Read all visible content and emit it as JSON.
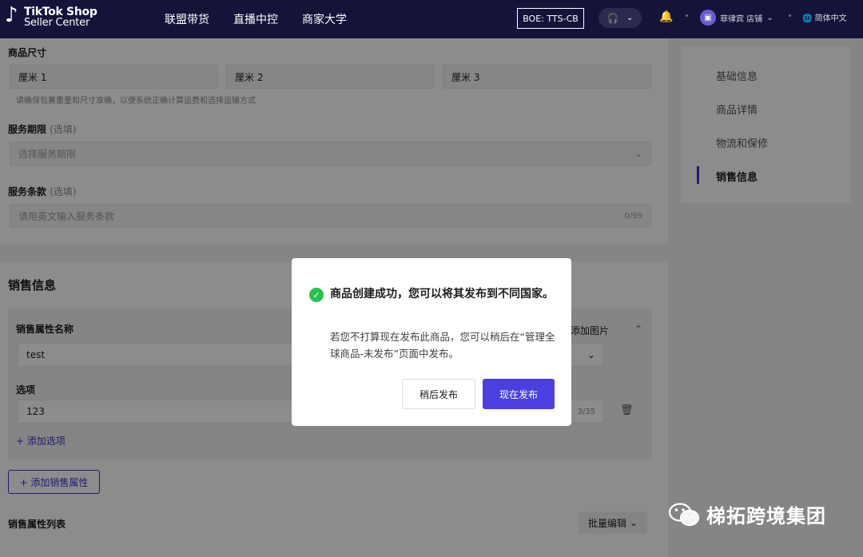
{
  "nav": {
    "logo_line1": "TikTok Shop",
    "logo_line2": "Seller Center",
    "items": [
      "联盟带货",
      "直播中控",
      "商家大学"
    ],
    "boe": "BOE: TTS-CB",
    "user": "菲律宾 店铺",
    "lang": "简体中文"
  },
  "form": {
    "size_label": "商品尺寸",
    "size_fields": [
      "厘米  1",
      "厘米  2",
      "厘米  3"
    ],
    "size_hint": "请确保包裹重量和尺寸准确，以便系统正确计算运费和选择运输方式",
    "service_period_label": "服务期限",
    "optional": "(选填)",
    "service_period_placeholder": "选择服务期限",
    "service_terms_label": "服务条款",
    "service_terms_placeholder": "请用英文输入服务条款",
    "service_terms_count": "0/99"
  },
  "anchors": [
    "基础信息",
    "商品详情",
    "物流和保修",
    "销售信息"
  ],
  "sales": {
    "title": "销售信息",
    "attr_name_label": "销售属性名称",
    "attr_name_value": "test",
    "add_image": "添加图片",
    "options_label": "选项",
    "option_value": "123",
    "option_count": "3/35",
    "add_option": "+ 添加选项",
    "add_attr": "+ 添加销售属性",
    "list_label": "销售属性列表",
    "batch_edit": "批量编辑"
  },
  "modal": {
    "title": "商品创建成功，您可以将其发布到不同国家。",
    "body": "若您不打算现在发布此商品，您可以稍后在“管理全球商品-未发布”页面中发布。",
    "later": "稍后发布",
    "now": "现在发布"
  },
  "watermark": "梯拓跨境集团"
}
